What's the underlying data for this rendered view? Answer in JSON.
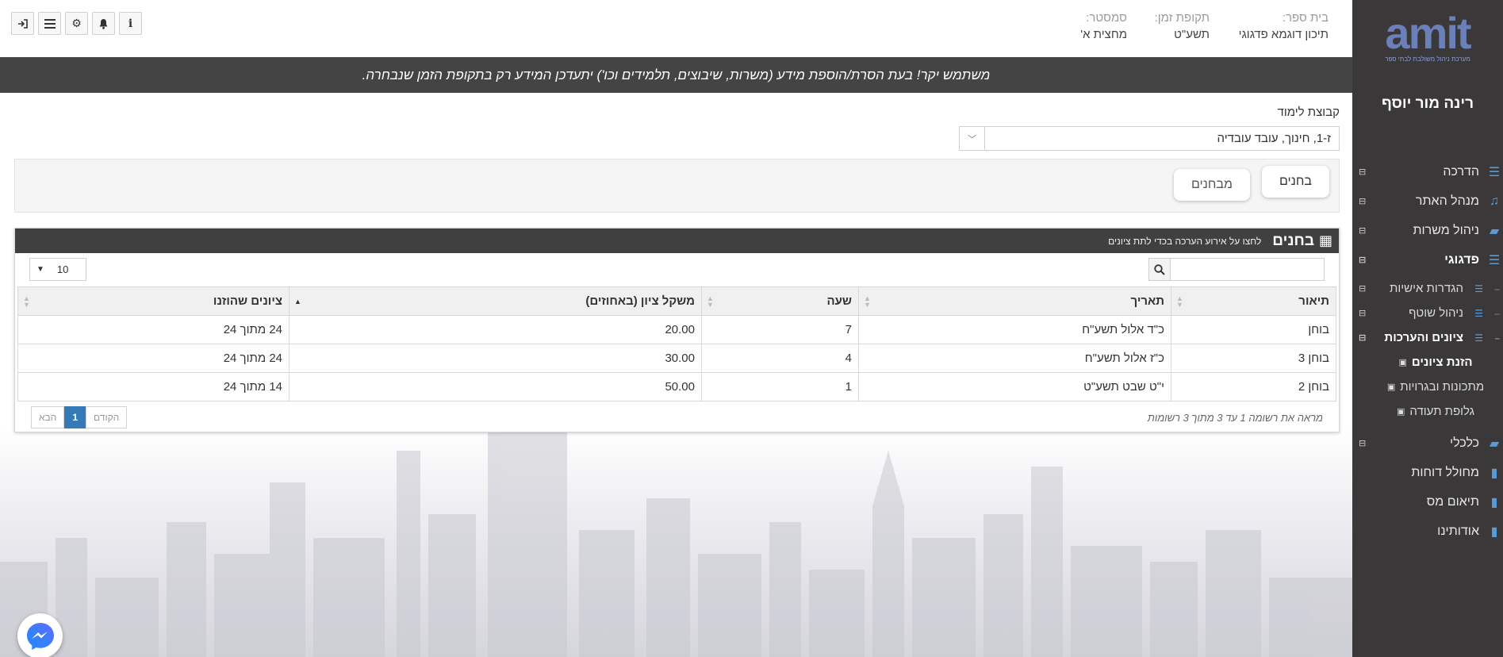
{
  "header": {
    "school_label": "בית ספר:",
    "school_value": "תיכון דוגמא פדגוגי",
    "period_label": "תקופת זמן:",
    "period_value": "תשע\"ט",
    "semester_label": "סמסטר:",
    "semester_value": "מחצית א'"
  },
  "toolbar": {
    "icons": [
      "info-icon",
      "bell-icon",
      "gear-icon",
      "menu-icon",
      "logout-icon"
    ]
  },
  "notice": "משתמש יקר! בעת הסרת/הוספת מידע (משרות, שיבוצים, תלמידים וכו') יתעדכן המידע רק בתקופת הזמן שנבחרה.",
  "sidebar": {
    "logo_text": "amit",
    "logo_tagline": "מערכת ניהול משולבת לבתי ספר",
    "user_name": "רינה מור יוסף",
    "items": [
      {
        "label": "הדרכה",
        "icon": "list-icon"
      },
      {
        "label": "מנהל האתר",
        "icon": "music-icon"
      },
      {
        "label": "ניהול משרות",
        "icon": "book-icon"
      },
      {
        "label": "פדגוגי",
        "icon": "list-icon"
      }
    ],
    "sub_items": [
      {
        "label": "הגדרות אישיות",
        "icon": "list-icon"
      },
      {
        "label": "ניהול שוטף",
        "icon": "list-icon"
      },
      {
        "label": "ציונים והערכות",
        "icon": "list-icon"
      }
    ],
    "leaf_items": [
      {
        "label": "הזנת ציונים",
        "icon": "book-icon"
      },
      {
        "label": "מתכונות ובגרויות",
        "icon": "book-icon"
      },
      {
        "label": "גלופת תעודה",
        "icon": "book-icon"
      }
    ],
    "bottom_items": [
      {
        "label": "כלכלי",
        "icon": "book-icon"
      },
      {
        "label": "מחולל דוחות",
        "icon": "folder-icon"
      },
      {
        "label": "תיאום מס",
        "icon": "folder-icon"
      },
      {
        "label": "אודותינו",
        "icon": "folder-icon"
      }
    ]
  },
  "main": {
    "group_label": "קבוצת לימוד",
    "group_value": "ז-1, חינוך, עובד עובדיה",
    "tabs": [
      {
        "label": "בחנים"
      },
      {
        "label": "מבחנים"
      }
    ],
    "card": {
      "title": "בחנים",
      "subtitle": "לחצו על אירוע הערכה בכדי לתת ציונים",
      "page_size": "10",
      "search_value": "",
      "columns": [
        "תיאור",
        "תאריך",
        "שעה",
        "משקל ציון (באחוזים)",
        "ציונים שהוזנו"
      ],
      "rows": [
        [
          "בוחן",
          "כ\"ד אלול תשע\"ח",
          "7",
          "20.00",
          "24 מתוך 24"
        ],
        [
          "בוחן 3",
          "כ\"ז אלול תשע\"ח",
          "4",
          "30.00",
          "24 מתוך 24"
        ],
        [
          "בוחן 2",
          "י\"ט שבט תשע\"ט",
          "1",
          "50.00",
          "14 מתוך 24"
        ]
      ],
      "records_info": "מראה את רשומה 1 עד 3 מתוך 3 רשומות",
      "pager": {
        "prev": "הקודם",
        "current": "1",
        "next": "הבא"
      }
    }
  },
  "colors": {
    "sidebar_bg": "#3a3838",
    "notice_bg": "#444444",
    "accent": "#337ab7",
    "logo": "#6b7fb8"
  }
}
